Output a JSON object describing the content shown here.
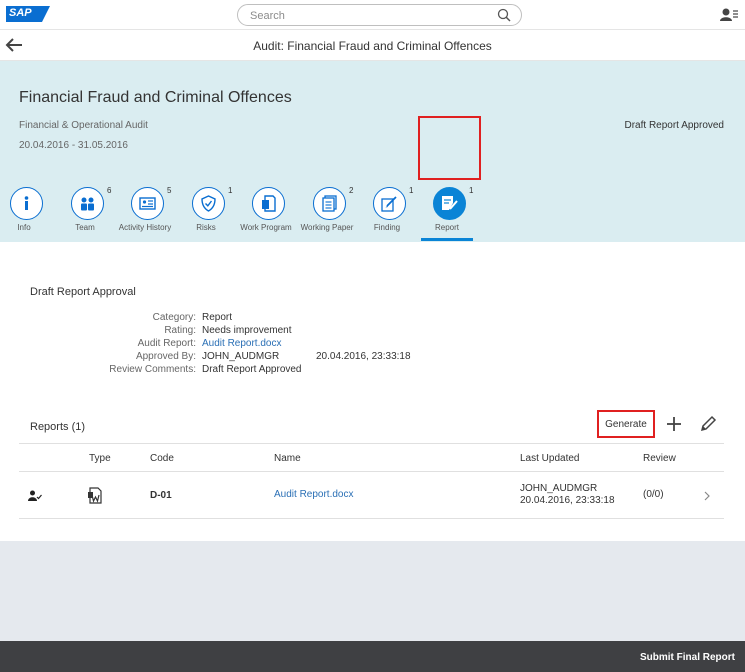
{
  "shell": {
    "logo_text": "SAP",
    "search_placeholder": "Search"
  },
  "nav": {
    "title": "Audit: Financial Fraud and Criminal Offences"
  },
  "header": {
    "title": "Financial Fraud and Criminal Offences",
    "subtitle": "Financial & Operational Audit",
    "dates": "20.04.2016 - 31.05.2016",
    "status": "Draft Report Approved"
  },
  "tabs": [
    {
      "label": "Info",
      "count": "",
      "icon": "info-icon"
    },
    {
      "label": "Team",
      "count": "6",
      "icon": "team-icon"
    },
    {
      "label": "Activity History",
      "count": "5",
      "icon": "activity-icon"
    },
    {
      "label": "Risks",
      "count": "1",
      "icon": "risk-icon"
    },
    {
      "label": "Work Program",
      "count": "",
      "icon": "work-program-icon"
    },
    {
      "label": "Working Paper",
      "count": "2",
      "icon": "working-paper-icon"
    },
    {
      "label": "Finding",
      "count": "1",
      "icon": "finding-icon"
    },
    {
      "label": "Report",
      "count": "1",
      "icon": "report-icon"
    }
  ],
  "approval": {
    "title": "Draft Report Approval",
    "fields": [
      {
        "label": "Category:",
        "value": "Report"
      },
      {
        "label": "Rating:",
        "value": "Needs improvement"
      },
      {
        "label": "Audit Report:",
        "value": "Audit Report.docx"
      },
      {
        "label": "Approved By:",
        "value": "JOHN_AUDMGR",
        "value2": "20.04.2016, 23:33:18"
      },
      {
        "label": "Review Comments:",
        "value": "Draft Report Approved"
      }
    ]
  },
  "reports": {
    "title": "Reports (1)",
    "generate_label": "Generate",
    "columns": {
      "type": "Type",
      "code": "Code",
      "name": "Name",
      "last_updated": "Last Updated",
      "review": "Review"
    },
    "rows": [
      {
        "code": "D-01",
        "name": "Audit Report.docx",
        "updated_by": "JOHN_AUDMGR",
        "updated_at": "20.04.2016, 23:33:18",
        "review": "(0/0)"
      }
    ]
  },
  "footer": {
    "submit_label": "Submit Final Report"
  }
}
